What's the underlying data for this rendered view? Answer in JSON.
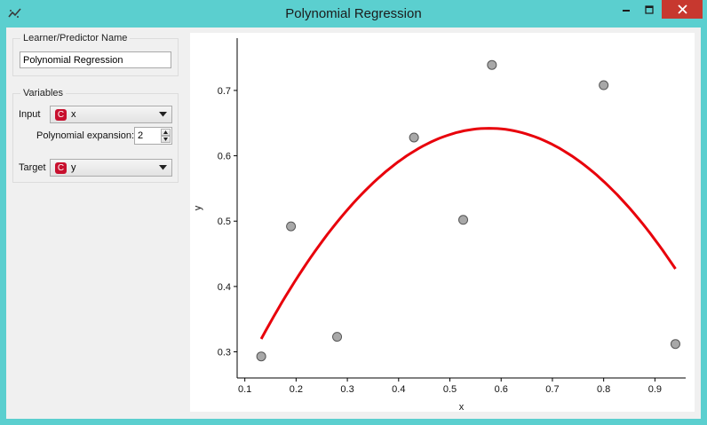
{
  "window": {
    "title": "Polynomial Regression",
    "icon": "scatter-line-icon"
  },
  "learner": {
    "group_label": "Learner/Predictor Name",
    "name_value": "Polynomial Regression"
  },
  "variables": {
    "group_label": "Variables",
    "input_label": "Input",
    "input_value": "x",
    "input_badge": "C",
    "expansion_label": "Polynomial expansion:",
    "expansion_value": "2",
    "target_label": "Target",
    "target_value": "y",
    "target_badge": "C"
  },
  "colors": {
    "accent_titlebar": "#5bcfcf",
    "close_button": "#c7382f",
    "variable_badge": "#c8102e",
    "curve": "#e8000b",
    "points_fill": "#a8a8a8"
  },
  "chart_data": {
    "type": "scatter",
    "xlabel": "x",
    "ylabel": "y",
    "xlim": [
      0.085,
      0.96
    ],
    "ylim": [
      0.26,
      0.78
    ],
    "xticks": [
      0.1,
      0.2,
      0.3,
      0.4,
      0.5,
      0.6,
      0.7,
      0.8,
      0.9
    ],
    "yticks": [
      0.3,
      0.4,
      0.5,
      0.6,
      0.7
    ],
    "points": [
      {
        "x": 0.132,
        "y": 0.293
      },
      {
        "x": 0.19,
        "y": 0.492
      },
      {
        "x": 0.28,
        "y": 0.323
      },
      {
        "x": 0.43,
        "y": 0.628
      },
      {
        "x": 0.526,
        "y": 0.502
      },
      {
        "x": 0.582,
        "y": 0.739
      },
      {
        "x": 0.8,
        "y": 0.708
      },
      {
        "x": 0.94,
        "y": 0.312
      }
    ],
    "curve": {
      "degree": 2,
      "coefficients": [
        0.1,
        1.88,
        -1.63
      ],
      "x_range": [
        0.132,
        0.94
      ]
    },
    "grid": false
  }
}
